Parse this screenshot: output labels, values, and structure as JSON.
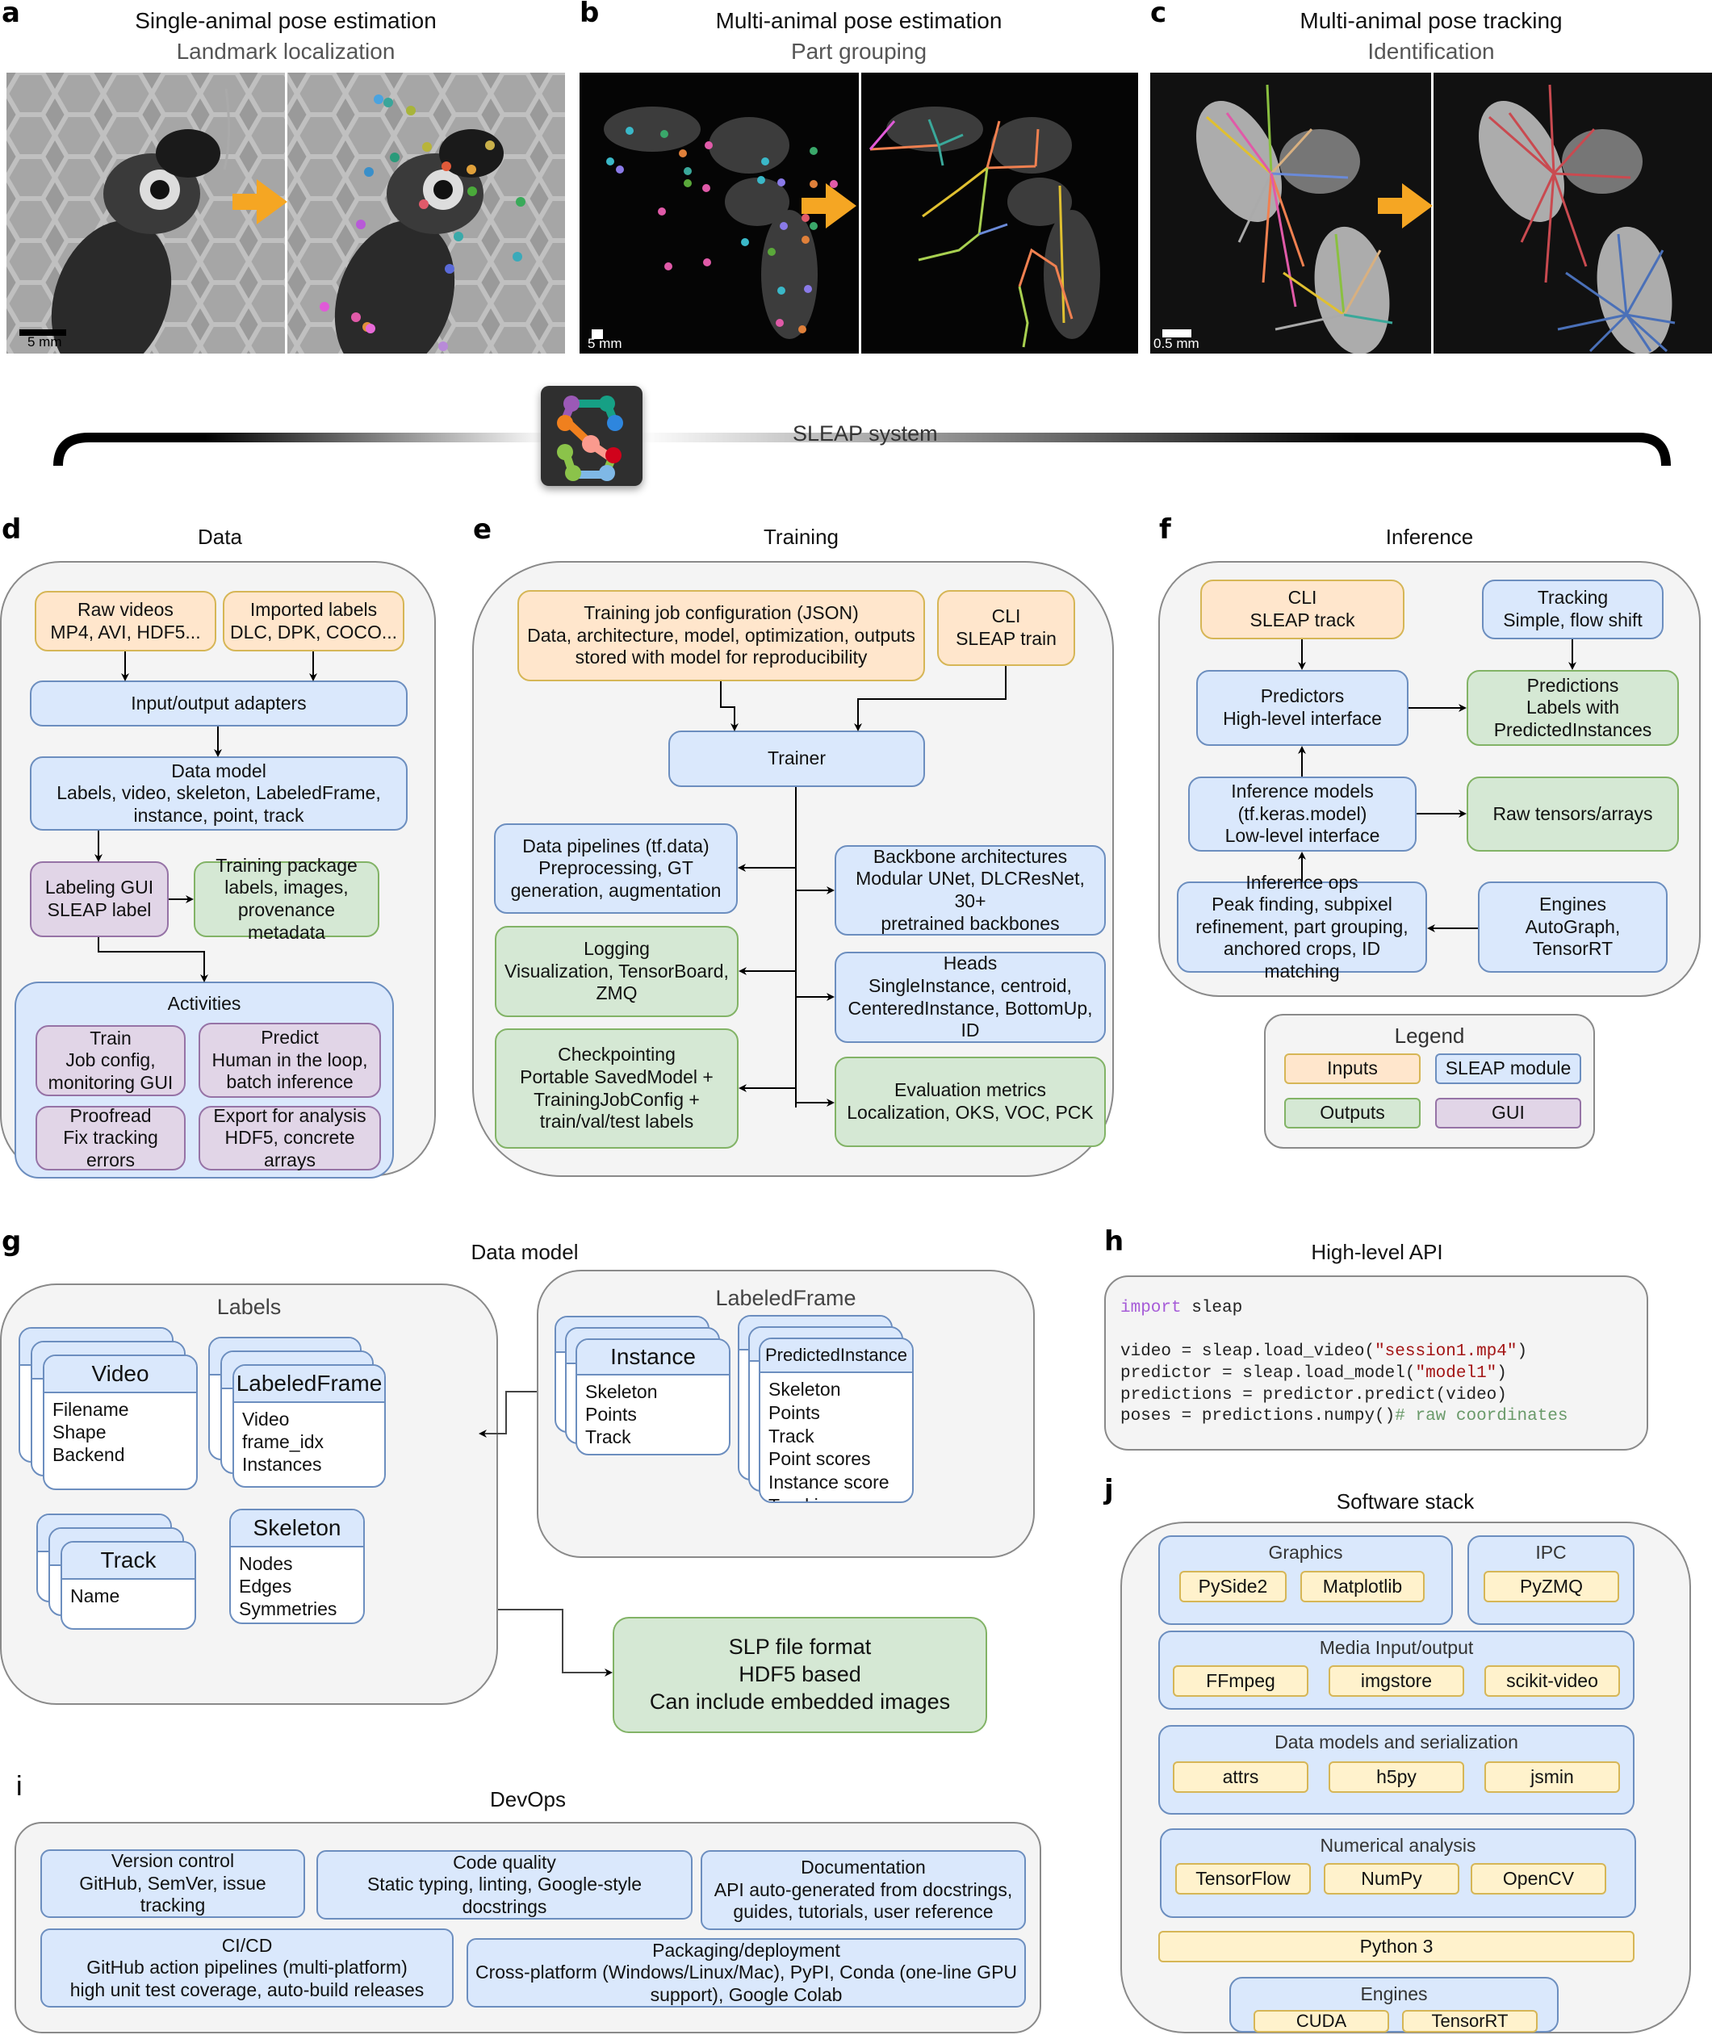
{
  "panel_a": {
    "letter": "a",
    "title": "Single-animal pose estimation",
    "subtitle": "Landmark localization",
    "scale_bar": "5 mm"
  },
  "panel_b": {
    "letter": "b",
    "title": "Multi-animal pose estimation",
    "subtitle": "Part grouping",
    "scale_bar": "5 mm"
  },
  "panel_c": {
    "letter": "c",
    "title": "Multi-animal pose tracking",
    "subtitle": "Identification",
    "scale_bar": "0.5 mm"
  },
  "system": {
    "label": "SLEAP system",
    "logo_colors": [
      "#9b59b6",
      "#16a085",
      "#2e86de",
      "#f0801e",
      "#fa9a8e",
      "#d0021b",
      "#8bc34a",
      "#7fb8e6"
    ]
  },
  "colors": {
    "inputs": "#ffe6cc",
    "module": "#dae8fc",
    "outputs": "#d5e8d4",
    "gui": "#e1d5e7",
    "package": "#fff2cc",
    "arrow": "#f5a623"
  },
  "panel_d": {
    "letter": "d",
    "title": "Data",
    "raw_videos": [
      "Raw videos",
      "MP4, AVI, HDF5..."
    ],
    "imported_labels": [
      "Imported labels",
      "DLC, DPK, COCO..."
    ],
    "io_adapters": "Input/output adapters",
    "data_model": [
      "Data model",
      "Labels, video, skeleton, LabeledFrame,",
      "instance, point, track"
    ],
    "labeling_gui": [
      "Labeling GUI",
      "SLEAP label"
    ],
    "training_package": [
      "Training package",
      "labels, images,",
      "provenance metadata"
    ],
    "activities": {
      "title": "Activities",
      "items": [
        [
          "Train",
          "Job config,",
          "monitoring GUI"
        ],
        [
          "Predict",
          "Human in the loop,",
          "batch inference"
        ],
        [
          "Proofread",
          "Fix tracking errors"
        ],
        [
          "Export for analysis",
          "HDF5, concrete arrays"
        ]
      ]
    }
  },
  "panel_e": {
    "letter": "e",
    "title": "Training",
    "job_config": [
      "Training job configuration (JSON)",
      "Data, architecture, model, optimization, outputs",
      "stored with model for reproducibility"
    ],
    "cli": [
      "CLI",
      "SLEAP train"
    ],
    "trainer": "Trainer",
    "data_pipelines": [
      "Data pipelines (tf.data)",
      "Preprocessing, GT",
      "generation, augmentation"
    ],
    "logging": [
      "Logging",
      "Visualization, TensorBoard,",
      "ZMQ"
    ],
    "checkpointing": [
      "Checkpointing",
      "Portable SavedModel +",
      "TrainingJobConfig +",
      "train/val/test labels"
    ],
    "backbones": [
      "Backbone architectures",
      "Modular UNet, DLCResNet, 30+",
      "pretrained backbones"
    ],
    "heads": [
      "Heads",
      "SingleInstance, centroid,",
      "CenteredInstance, BottomUp,",
      "ID"
    ],
    "evaluation": [
      "Evaluation metrics",
      "Localization, OKS, VOC, PCK"
    ]
  },
  "panel_f": {
    "letter": "f",
    "title": "Inference",
    "cli": [
      "CLI",
      "SLEAP track"
    ],
    "tracking": [
      "Tracking",
      "Simple, flow shift"
    ],
    "predictors": [
      "Predictors",
      "High-level interface"
    ],
    "predictions": [
      "Predictions",
      "Labels with",
      "PredictedInstances"
    ],
    "inference_models": [
      "Inference models",
      "(tf.keras.model)",
      "Low-level interface"
    ],
    "raw_tensors": "Raw tensors/arrays",
    "inference_ops": [
      "Inference ops",
      "Peak finding, subpixel",
      "refinement, part grouping,",
      "anchored crops, ID matching"
    ],
    "engines": [
      "Engines",
      "AutoGraph, TensorRT"
    ]
  },
  "legend": {
    "title": "Legend",
    "inputs": "Inputs",
    "module": "SLEAP module",
    "outputs": "Outputs",
    "gui": "GUI"
  },
  "panel_g": {
    "letter": "g",
    "title": "Data model",
    "labels_group": "Labels",
    "video": {
      "name": "Video",
      "fields": [
        "Filename",
        "Shape",
        "Backend"
      ]
    },
    "labeled_frame": {
      "name": "LabeledFrame",
      "fields": [
        "Video",
        "frame_idx",
        "Instances"
      ]
    },
    "track": {
      "name": "Track",
      "fields": [
        "Name"
      ]
    },
    "skeleton": {
      "name": "Skeleton",
      "fields": [
        "Nodes",
        "Edges",
        "Symmetries"
      ]
    },
    "frame_group": "LabeledFrame",
    "instance": {
      "name": "Instance",
      "fields": [
        "Skeleton",
        "Points",
        "Track"
      ]
    },
    "predicted_instance": {
      "name": "PredictedInstance",
      "fields": [
        "Skeleton",
        "Points",
        "Track",
        "Point scores",
        "Instance score",
        "Tracking score"
      ]
    },
    "slp": [
      "SLP file format",
      "HDF5 based",
      "Can include embedded images"
    ]
  },
  "panel_h": {
    "letter": "h",
    "title": "High-level API",
    "code": {
      "l1_kw": "import",
      "l1_rest": " sleap",
      "l2_pre": "video = sleap.load_video(",
      "l2_str": "\"session1.mp4\"",
      "l2_post": ")",
      "l3_pre": "predictor = sleap.load_model(",
      "l3_str": "\"model1\"",
      "l3_post": ")",
      "l4": "predictions = predictor.predict(video)",
      "l5_pre": "poses = predictions.numpy()",
      "l5_cm": "# raw coordinates"
    }
  },
  "panel_i": {
    "letter": "i",
    "title": "DevOps",
    "items": [
      [
        "Version control",
        "GitHub, SemVer, issue tracking"
      ],
      [
        "Code quality",
        "Static typing, linting, Google-style docstrings"
      ],
      [
        "Documentation",
        "API auto-generated from docstrings,",
        "guides, tutorials, user reference"
      ],
      [
        "CI/CD",
        "GitHub action pipelines (multi-platform)",
        "high unit test coverage, auto-build releases"
      ],
      [
        "Packaging/deployment",
        "Cross-platform (Windows/Linux/Mac), PyPI, Conda (one-line GPU",
        "support), Google Colab"
      ]
    ]
  },
  "panel_j": {
    "letter": "j",
    "title": "Software stack",
    "graphics": {
      "title": "Graphics",
      "items": [
        "PySide2",
        "Matplotlib"
      ]
    },
    "ipc": {
      "title": "IPC",
      "items": [
        "PyZMQ"
      ]
    },
    "media": {
      "title": "Media Input/output",
      "items": [
        "FFmpeg",
        "imgstore",
        "scikit-video"
      ]
    },
    "datamodels": {
      "title": "Data models and serialization",
      "items": [
        "attrs",
        "h5py",
        "jsmin"
      ]
    },
    "numerical": {
      "title": "Numerical analysis",
      "items": [
        "TensorFlow",
        "NumPy",
        "OpenCV"
      ]
    },
    "python": "Python 3",
    "engines": {
      "title": "Engines",
      "items": [
        "CUDA",
        "TensorRT"
      ]
    }
  }
}
